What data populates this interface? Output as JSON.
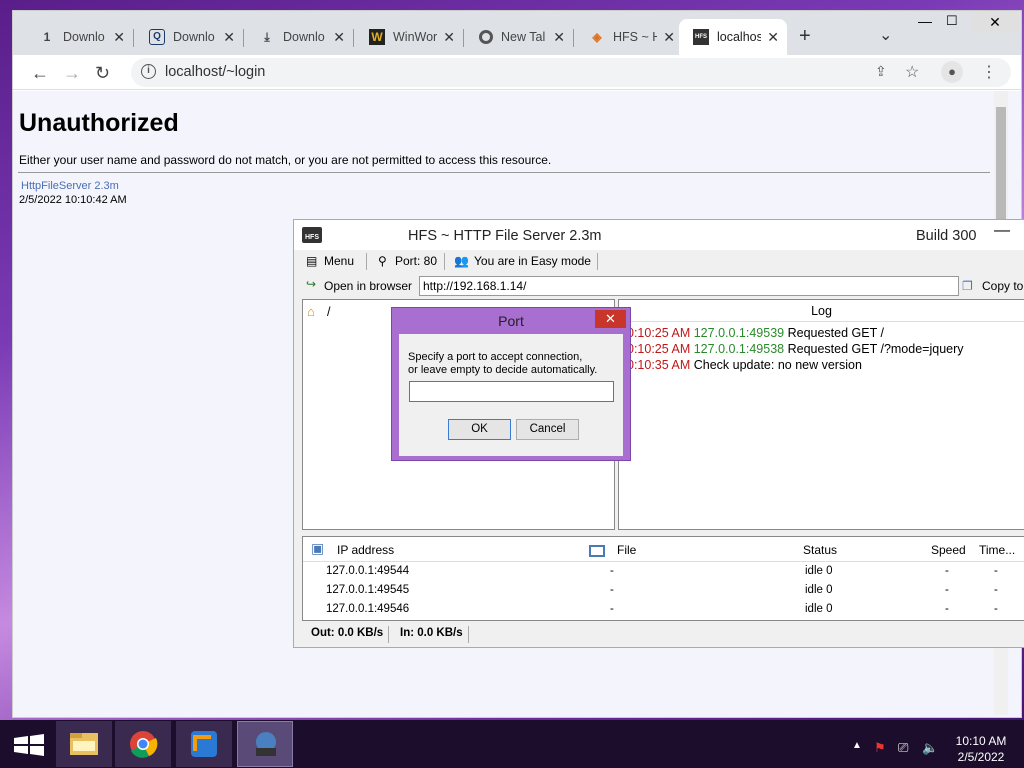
{
  "browser": {
    "tabs": [
      {
        "label": "Downlo",
        "icon": "1"
      },
      {
        "label": "Downlo",
        "icon": "Q"
      },
      {
        "label": "Downlo",
        "icon": "⤓"
      },
      {
        "label": "WinWor",
        "icon": "W"
      },
      {
        "label": "New Tal",
        "icon": "G"
      },
      {
        "label": "HFS ~ H",
        "icon": "◈"
      },
      {
        "label": "localhos",
        "icon": "HFS"
      }
    ],
    "url": "localhost/~login",
    "new_tab": "+",
    "tab_menu": "⌄"
  },
  "page": {
    "title": "Unauthorized",
    "message": "Either your user name and password do not match, or you are not permitted to access this resource.",
    "server": "HttpFileServer 2.3m",
    "datetime": "2/5/2022 10:10:42 AM"
  },
  "hfs": {
    "title": "HFS ~ HTTP File Server 2.3m",
    "build": "Build 300",
    "menu": "Menu",
    "port": "Port: 80",
    "mode": "You are in Easy mode",
    "open_browser": "Open in browser",
    "url": "http://192.168.1.14/",
    "copy": "Copy to",
    "vfs_root": "/",
    "log_header": "Log",
    "log": [
      {
        "time": "0:10:25 AM",
        "ip": "127.0.0.1:49539",
        "msg": "Requested GET /"
      },
      {
        "time": "0:10:25 AM",
        "ip": "127.0.0.1:49538",
        "msg": "Requested GET /?mode=jquery"
      },
      {
        "time": "0:10:35 AM",
        "ip": "",
        "msg": "Check update: no new version"
      }
    ],
    "columns": {
      "ip": "IP address",
      "file": "File",
      "status": "Status",
      "speed": "Speed",
      "time": "Time..."
    },
    "connections": [
      {
        "ip": "127.0.0.1:49544",
        "file": "-",
        "status": "idle 0",
        "speed": "-",
        "time": "-"
      },
      {
        "ip": "127.0.0.1:49545",
        "file": "-",
        "status": "idle 0",
        "speed": "-",
        "time": "-"
      },
      {
        "ip": "127.0.0.1:49546",
        "file": "-",
        "status": "idle 0",
        "speed": "-",
        "time": "-"
      }
    ],
    "out": "Out: 0.0 KB/s",
    "in": "In: 0.0 KB/s"
  },
  "dialog": {
    "title": "Port",
    "text1": "Specify a port to accept connection,",
    "text2": "or leave empty to decide automatically.",
    "value": "",
    "ok": "OK",
    "cancel": "Cancel",
    "close": "✕"
  },
  "taskbar": {
    "time": "10:10 AM",
    "date": "2/5/2022"
  }
}
